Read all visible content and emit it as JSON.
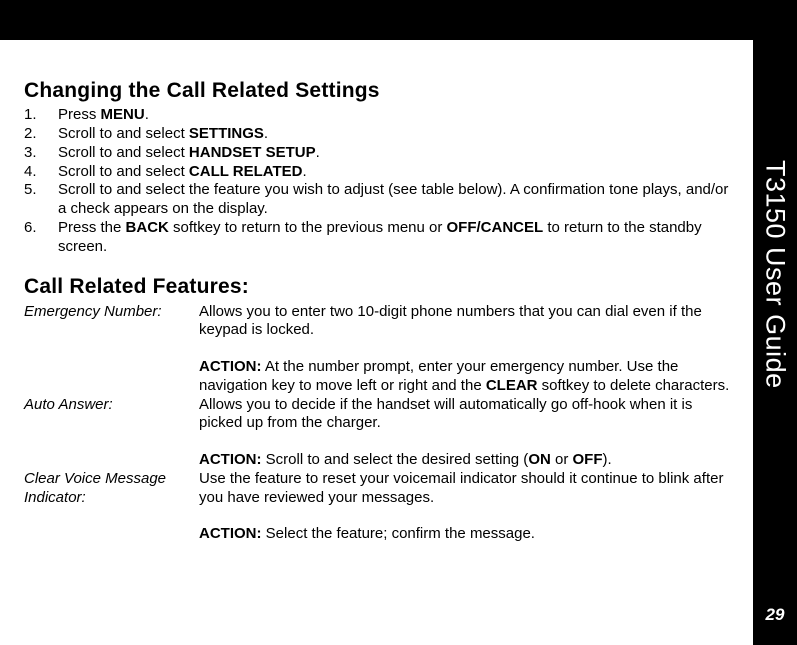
{
  "sidebar": {
    "guide": "T3150 User Guide",
    "page": "29"
  },
  "section1": {
    "heading": "Changing the Call Related Settings",
    "steps": [
      {
        "n": "1.",
        "pre": "Press ",
        "b1": "MENU",
        "post": "."
      },
      {
        "n": "2.",
        "pre": "Scroll to and select ",
        "b1": "SETTINGS",
        "post": "."
      },
      {
        "n": "3.",
        "pre": "Scroll to and select ",
        "b1": "HANDSET SETUP",
        "post": "."
      },
      {
        "n": "4.",
        "pre": "Scroll to and select ",
        "b1": "CALL RELATED",
        "post": "."
      },
      {
        "n": "5.",
        "pre": "Scroll to and select the feature you wish to adjust (see table below). A confirmation tone plays, and/or a check appears on the display.",
        "b1": "",
        "post": ""
      },
      {
        "n": "6.",
        "pre": "Press the ",
        "b1": "BACK",
        "mid": " softkey to return to the previous menu or ",
        "b2": "OFF/CANCEL",
        "post": " to return to the standby screen."
      }
    ]
  },
  "section2": {
    "heading": "Call Related Features:",
    "features": [
      {
        "label": "Emergency Number:",
        "desc": "Allows you to enter two 10-digit phone numbers that you can dial even if the keypad is locked.",
        "action_label": "ACTION:",
        "action_pre": " At the number prompt, enter your emergency number. Use the navigation key to move left or right and the ",
        "action_b1": "CLEAR",
        "action_post": " softkey to delete characters."
      },
      {
        "label": "Auto Answer:",
        "desc": "Allows you to decide if the handset will automatically go off-hook when it is picked up from the charger.",
        "action_label": "ACTION:",
        "action_pre": " Scroll to and select the desired setting (",
        "action_b1": "ON",
        "action_mid": " or ",
        "action_b2": "OFF",
        "action_post": ")."
      },
      {
        "label": "Clear Voice Message Indicator:",
        "desc": "Use the feature to reset your voicemail indicator should it continue to blink after you have reviewed your messages.",
        "action_label": "ACTION:",
        "action_pre": " Select the feature; confirm the message.",
        "action_b1": "",
        "action_post": ""
      }
    ]
  }
}
